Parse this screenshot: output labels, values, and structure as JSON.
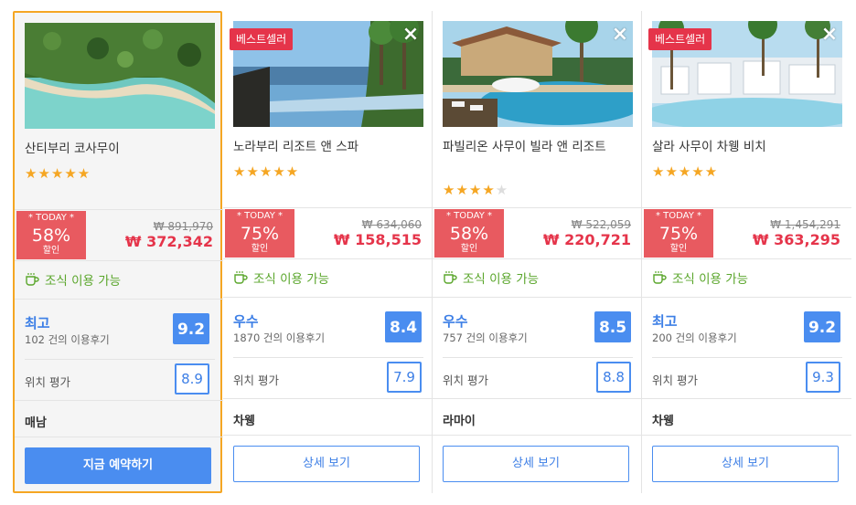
{
  "hotels": [
    {
      "name": "산티부리 코사무이",
      "badge": "",
      "stars": "★★★★★",
      "stars_dim": "",
      "today_label": "* TODAY *",
      "discount": "58%",
      "discount_label": "할인",
      "old_price": "₩ 891,970",
      "new_price": "₩ 372,342",
      "breakfast": "조식 이용 가능",
      "grade": "최고",
      "reviews": "102 건의 이용후기",
      "score": "9.2",
      "location_label": "위치 평가",
      "location_score": "8.9",
      "city": "매남",
      "button": "지금 예약하기"
    },
    {
      "name": "노라부리 리조트 앤 스파",
      "badge": "베스트셀러",
      "stars": "★★★★★",
      "stars_dim": "",
      "today_label": "* TODAY *",
      "discount": "75%",
      "discount_label": "할인",
      "old_price": "₩ 634,060",
      "new_price": "₩ 158,515",
      "breakfast": "조식 이용 가능",
      "grade": "우수",
      "reviews": "1870 건의 이용후기",
      "score": "8.4",
      "location_label": "위치 평가",
      "location_score": "7.9",
      "city": "차웽",
      "button": "상세 보기"
    },
    {
      "name": "파빌리온 사무이 빌라 앤 리조트",
      "badge": "",
      "stars": "★★★★",
      "stars_dim": "★",
      "today_label": "* TODAY *",
      "discount": "58%",
      "discount_label": "할인",
      "old_price": "₩ 522,059",
      "new_price": "₩ 220,721",
      "breakfast": "조식 이용 가능",
      "grade": "우수",
      "reviews": "757 건의 이용후기",
      "score": "8.5",
      "location_label": "위치 평가",
      "location_score": "8.8",
      "city": "라마이",
      "button": "상세 보기"
    },
    {
      "name": "살라 사무이 차웽 비치",
      "badge": "베스트셀러",
      "stars": "★★★★★",
      "stars_dim": "",
      "today_label": "* TODAY *",
      "discount": "75%",
      "discount_label": "할인",
      "old_price": "₩ 1,454,291",
      "new_price": "₩ 363,295",
      "breakfast": "조식 이용 가능",
      "grade": "최고",
      "reviews": "200 건의 이용후기",
      "score": "9.2",
      "location_label": "위치 평가",
      "location_score": "9.3",
      "city": "차웽",
      "button": "상세 보기"
    }
  ],
  "close_icon": "×",
  "colors": {
    "accent_blue": "#4a8df0",
    "sale_red": "#e5344a",
    "today_red": "#e85a60",
    "breakfast_green": "#5aa62b",
    "selected_border": "#f5a623"
  }
}
